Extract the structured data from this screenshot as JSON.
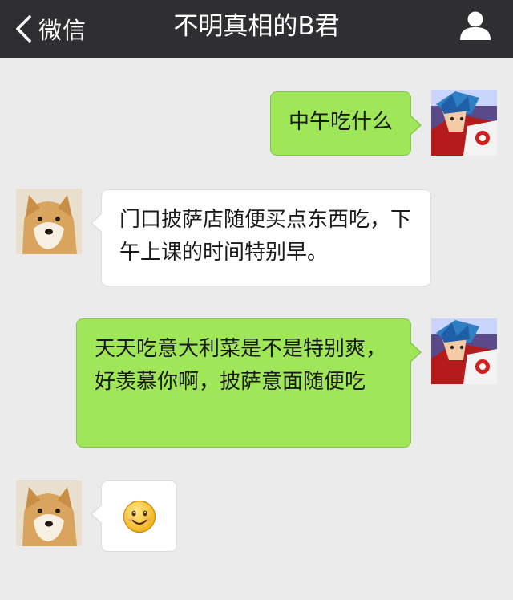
{
  "header": {
    "back_label": "微信",
    "title": "不明真相的B君",
    "back_icon": "chevron-left-icon",
    "profile_icon": "person-icon"
  },
  "messages": [
    {
      "from": "me",
      "text": "中午吃什么"
    },
    {
      "from": "contact",
      "text": "门口披萨店随便买点东西吃，下午上课的时间特别早。"
    },
    {
      "from": "me",
      "text": "天天吃意大利菜是不是特别爽，好羡慕你啊，披萨意面随便吃"
    },
    {
      "from": "contact",
      "emoji": "smiley-face-icon"
    }
  ],
  "colors": {
    "header_bg": "#2f2f32",
    "chat_bg": "#ebebeb",
    "sent_bubble": "#9fe658",
    "received_bubble": "#ffffff"
  }
}
